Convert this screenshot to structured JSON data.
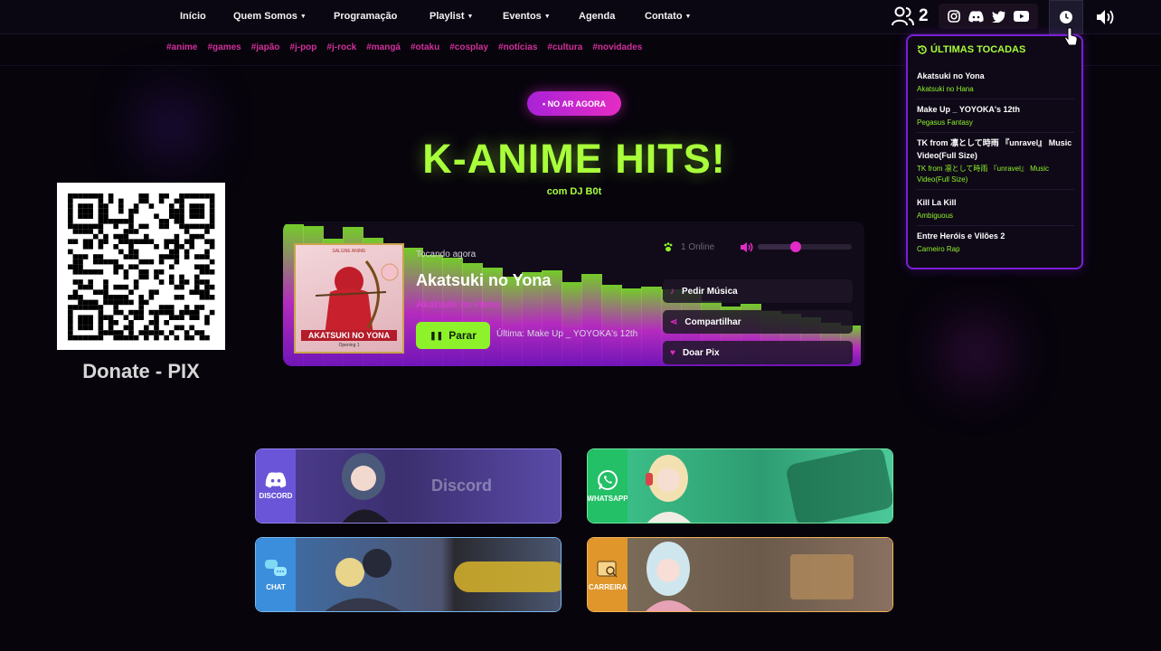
{
  "nav": {
    "items": [
      {
        "label": "Início",
        "dropdown": false
      },
      {
        "label": "Quem Somos",
        "dropdown": true
      },
      {
        "label": "Programação",
        "dropdown": false
      },
      {
        "label": "Playlist",
        "dropdown": true
      },
      {
        "label": "Eventos",
        "dropdown": true
      },
      {
        "label": "Agenda",
        "dropdown": false
      },
      {
        "label": "Contato",
        "dropdown": true
      }
    ],
    "listener_count": "2",
    "social_icons": [
      "instagram-icon",
      "discord-icon",
      "twitter-icon",
      "youtube-icon"
    ]
  },
  "tags": [
    "#anime",
    "#games",
    "#japão",
    "#j-pop",
    "#j-rock",
    "#mangá",
    "#otaku",
    "#cosplay",
    "#notícias",
    "#cultura",
    "#novidades"
  ],
  "hero": {
    "badge": "• NO AR AGORA",
    "title": "K-ANIME HITS!",
    "subtitle": "com DJ B0t"
  },
  "donate": {
    "caption": "Donate - PIX"
  },
  "player": {
    "art_tag": "SALGNE ANIME",
    "art_title": "AKATSUKI NO YONA",
    "art_subtitle": "Opening 1",
    "now_label": "Tocando agora",
    "track_title": "Akatsuki no Yona",
    "track_artist": "Akatsuki no Hana",
    "stop_label": "Parar",
    "last_played": "Última: Make Up _ YOYOKA's 12th",
    "online_text": "1 Online",
    "volume": 0.4,
    "actions": [
      "Pedir Música",
      "Compartilhar",
      "Doar Pix"
    ],
    "visualizer_levels": [
      0.98,
      0.97,
      0.88,
      0.96,
      0.89,
      0.79,
      0.82,
      0.77,
      0.75,
      0.71,
      0.68,
      0.62,
      0.65,
      0.66,
      0.58,
      0.64,
      0.56,
      0.54,
      0.55,
      0.53,
      0.51,
      0.45,
      0.41,
      0.43,
      0.38,
      0.36,
      0.34,
      0.3,
      0.28
    ]
  },
  "history": {
    "title": "ÚLTIMAS TOCADAS",
    "items": [
      {
        "title": "Akatsuki no Yona",
        "artist": "Akatsuki no Hana"
      },
      {
        "title": "Make Up _ YOYOKA's 12th",
        "artist": "Pegasus Fantasy"
      },
      {
        "title": "TK from 凛として時雨 『unravel』 Music Video(Full Size)",
        "artist": "TK from 凛として時雨 『unravel』 Music Video(Full Size)"
      },
      {
        "title": "Kill La Kill",
        "artist": "Ambiguous"
      },
      {
        "title": "Entre Heróis e Vilões 2",
        "artist": "Carneiro Rap"
      }
    ]
  },
  "cards": [
    {
      "label": "DISCORD",
      "word": "Discord",
      "icon": "discord-icon",
      "color": "#6a55d9"
    },
    {
      "label": "WHATSAPP",
      "word": "",
      "icon": "whatsapp-icon",
      "color": "#23c067"
    },
    {
      "label": "CHAT",
      "word": "",
      "icon": "chat-icon",
      "color": "#3b8edb"
    },
    {
      "label": "CARREIRA",
      "word": "",
      "icon": "job-icon",
      "color": "#e0962a"
    }
  ]
}
